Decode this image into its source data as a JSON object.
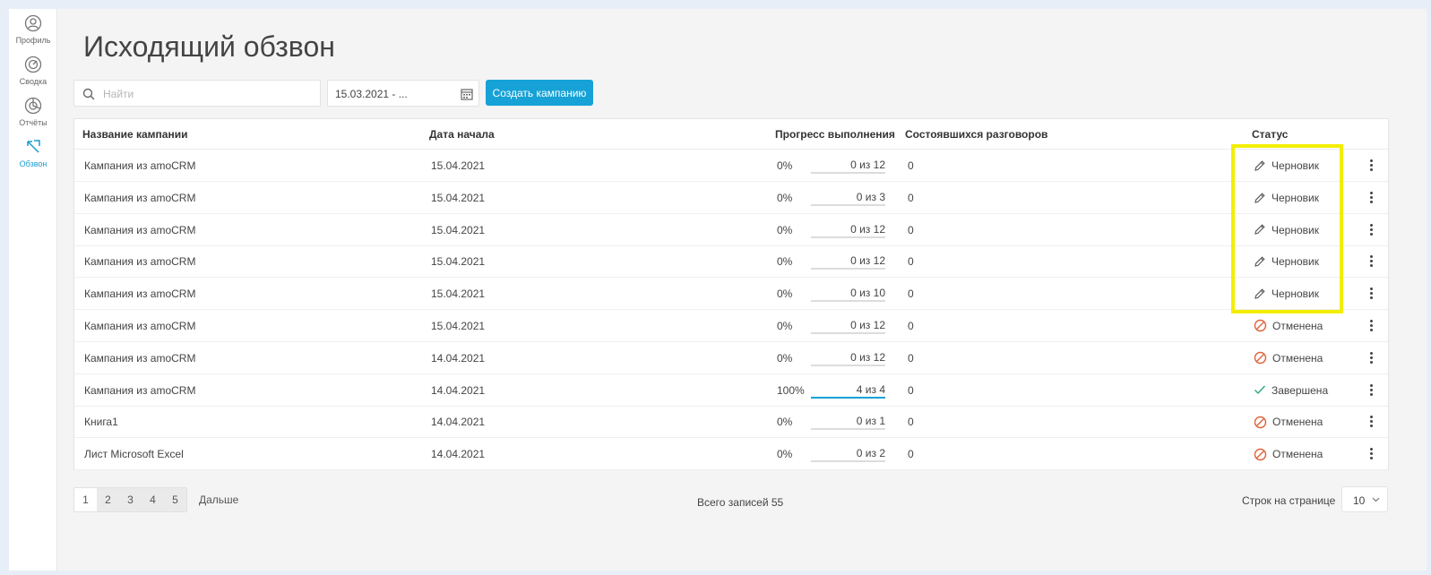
{
  "sidebar": {
    "items": [
      {
        "label": "Профиль",
        "icon": "profile-icon"
      },
      {
        "label": "Сводка",
        "icon": "dashboard-icon"
      },
      {
        "label": "Отчёты",
        "icon": "reports-icon"
      },
      {
        "label": "Обзвон",
        "icon": "outbound-call-icon",
        "active": true
      }
    ]
  },
  "page": {
    "title": "Исходящий обзвон"
  },
  "toolbar": {
    "search_placeholder": "Найти",
    "search_value": "",
    "date_range": "15.03.2021 - ...",
    "create_label": "Создать кампанию"
  },
  "table": {
    "headers": [
      "Название кампании",
      "Дата начала",
      "Прогресс выполнения",
      "Состоявшихся разговоров",
      "Статус"
    ],
    "rows": [
      {
        "name": "Кампания из amoCRM",
        "date": "15.04.2021",
        "percent": "0%",
        "progress": "0 из 12",
        "progress_value": 0,
        "talks": "0",
        "status": "Черновик",
        "status_type": "draft"
      },
      {
        "name": "Кампания из amoCRM",
        "date": "15.04.2021",
        "percent": "0%",
        "progress": "0 из 3",
        "progress_value": 0,
        "talks": "0",
        "status": "Черновик",
        "status_type": "draft"
      },
      {
        "name": "Кампания из amoCRM",
        "date": "15.04.2021",
        "percent": "0%",
        "progress": "0 из 12",
        "progress_value": 0,
        "talks": "0",
        "status": "Черновик",
        "status_type": "draft"
      },
      {
        "name": "Кампания из amoCRM",
        "date": "15.04.2021",
        "percent": "0%",
        "progress": "0 из 12",
        "progress_value": 0,
        "talks": "0",
        "status": "Черновик",
        "status_type": "draft"
      },
      {
        "name": "Кампания из amoCRM",
        "date": "15.04.2021",
        "percent": "0%",
        "progress": "0 из 10",
        "progress_value": 0,
        "talks": "0",
        "status": "Черновик",
        "status_type": "draft"
      },
      {
        "name": "Кампания из amoCRM",
        "date": "15.04.2021",
        "percent": "0%",
        "progress": "0 из 12",
        "progress_value": 0,
        "talks": "0",
        "status": "Отменена",
        "status_type": "cancelled"
      },
      {
        "name": "Кампания из amoCRM",
        "date": "14.04.2021",
        "percent": "0%",
        "progress": "0 из 12",
        "progress_value": 0,
        "talks": "0",
        "status": "Отменена",
        "status_type": "cancelled"
      },
      {
        "name": "Кампания из amoCRM",
        "date": "14.04.2021",
        "percent": "100%",
        "progress": "4 из 4",
        "progress_value": 1,
        "talks": "0",
        "status": "Завершена",
        "status_type": "done"
      },
      {
        "name": "Книга1",
        "date": "14.04.2021",
        "percent": "0%",
        "progress": "0 из 1",
        "progress_value": 0,
        "talks": "0",
        "status": "Отменена",
        "status_type": "cancelled"
      },
      {
        "name": "Лист Microsoft Excel",
        "date": "14.04.2021",
        "percent": "0%",
        "progress": "0 из 2",
        "progress_value": 0,
        "talks": "0",
        "status": "Отменена",
        "status_type": "cancelled"
      }
    ]
  },
  "pagination": {
    "pages": [
      "1",
      "2",
      "3",
      "4",
      "5"
    ],
    "current": "1",
    "next_label": "Дальше",
    "total": "Всего записей 55",
    "rows_per_page_label": "Строк на странице",
    "rows_per_page": "10"
  },
  "colors": {
    "accent": "#16a2d6",
    "cancelled": "#e0623a",
    "done": "#2aa876",
    "highlight": "#f3ee00"
  }
}
